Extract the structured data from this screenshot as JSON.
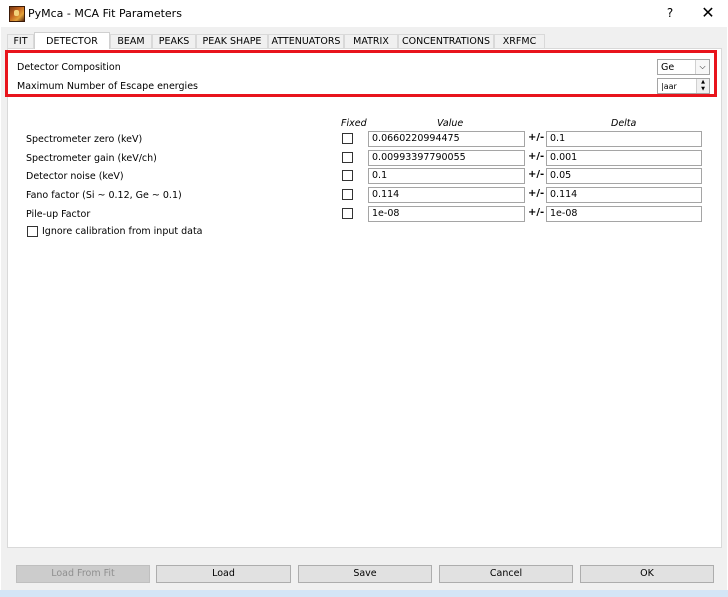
{
  "window": {
    "title": "PyMca - MCA Fit Parameters",
    "help_label": "?",
    "close_label": "✕"
  },
  "tabs": [
    "FIT",
    "DETECTOR",
    "BEAM",
    "PEAKS",
    "PEAK SHAPE",
    "ATTENUATORS",
    "MATRIX",
    "CONCENTRATIONS",
    "XRFMC"
  ],
  "active_tab": "DETECTOR",
  "detector": {
    "composition_label": "Detector Composition",
    "composition_value": "Ge",
    "escape_label": "Maximum Number of Escape energies",
    "escape_value": "|aar"
  },
  "table": {
    "headers": {
      "fixed": "Fixed",
      "value": "Value",
      "delta": "Delta"
    },
    "separator": "+/-",
    "rows": [
      {
        "label": "Spectrometer zero (keV)",
        "fixed": false,
        "value": "0.0660220994475",
        "delta": "0.1"
      },
      {
        "label": "Spectrometer gain (keV/ch)",
        "fixed": false,
        "value": "0.00993397790055",
        "delta": "0.001"
      },
      {
        "label": "Detector noise (keV)",
        "fixed": false,
        "value": "0.1",
        "delta": "0.05"
      },
      {
        "label": "Fano factor (Si ~ 0.12, Ge ~ 0.1)",
        "fixed": false,
        "value": "0.114",
        "delta": "0.114"
      },
      {
        "label": "Pile-up Factor",
        "fixed": false,
        "value": "1e-08",
        "delta": "1e-08"
      }
    ],
    "ignore_calibration_label": "Ignore calibration from input data",
    "ignore_calibration_checked": false
  },
  "buttons": {
    "load_from_fit": "Load From Fit",
    "load": "Load",
    "save": "Save",
    "cancel": "Cancel",
    "ok": "OK"
  },
  "colors": {
    "highlight": "#e8141c",
    "disabled_button": "#cccccc",
    "button": "#e1e1e1"
  }
}
